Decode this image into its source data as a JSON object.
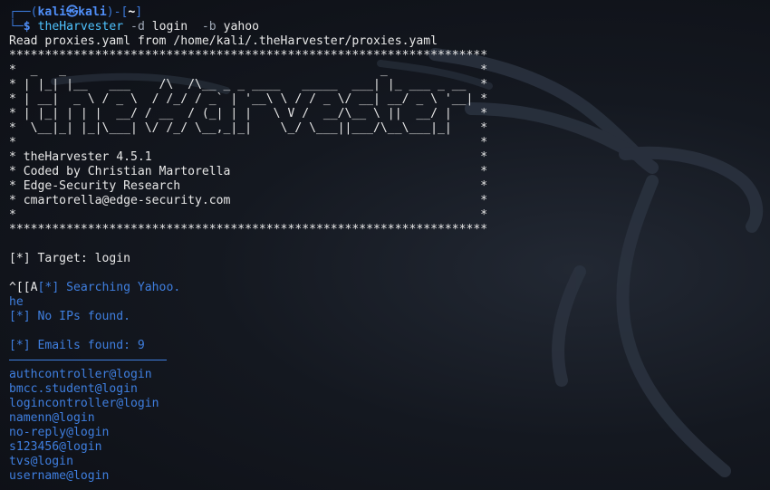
{
  "prompt": {
    "top_left": "┌──(",
    "user": "kali㉿kali",
    "mid": ")-[",
    "dir": "~",
    "end": "]",
    "bottom_left": "└─",
    "dollar": "$ ",
    "command_name": "theHarvester",
    "command_rest_1": " -d ",
    "arg_domain": "login",
    "command_rest_2": "  -b ",
    "arg_source": "yahoo"
  },
  "output": {
    "proxies_line": "Read proxies.yaml from /home/kali/.theHarvester/proxies.yaml",
    "banner": [
      "*******************************************************************",
      "*  _   _                                            _             *",
      "* | |_| |__   ___    /\\  /\\__ _ _ ____   _____  ___| |_ ___ _ __  *",
      "* | __|  _ \\ / _ \\  / /_/ / _` | '__\\ \\ / / _ \\/ __| __/ _ \\ '__| *",
      "* | |_| | | |  __/ / __  / (_| | |   \\ V /  __/\\__ \\ ||  __/ |    *",
      "*  \\__|_| |_|\\___| \\/ /_/ \\__,_|_|    \\_/ \\___||___/\\__\\___|_|    *",
      "*                                                                 *",
      "* theHarvester 4.5.1                                              *",
      "* Coded by Christian Martorella                                   *",
      "* Edge-Security Research                                          *",
      "* cmartorella@edge-security.com                                   *",
      "*                                                                 *",
      "*******************************************************************"
    ],
    "target_line": "[*] Target: login",
    "searching_prefix": "^[[A",
    "searching_line": "[*] Searching Yahoo.",
    "he_line": "he",
    "no_ips_line": "[*] No IPs found.",
    "emails_found_line": "[*] Emails found: 9",
    "emails": [
      "authcontroller@login",
      "bmcc.student@login",
      "logincontroller@login",
      "namenn@login",
      "no-reply@login",
      "s123456@login",
      "tvs@login",
      "username@login"
    ]
  },
  "colors": {
    "background": "#0f1117",
    "accent_blue": "#3f7fe0",
    "text": "#e8e8e8"
  }
}
